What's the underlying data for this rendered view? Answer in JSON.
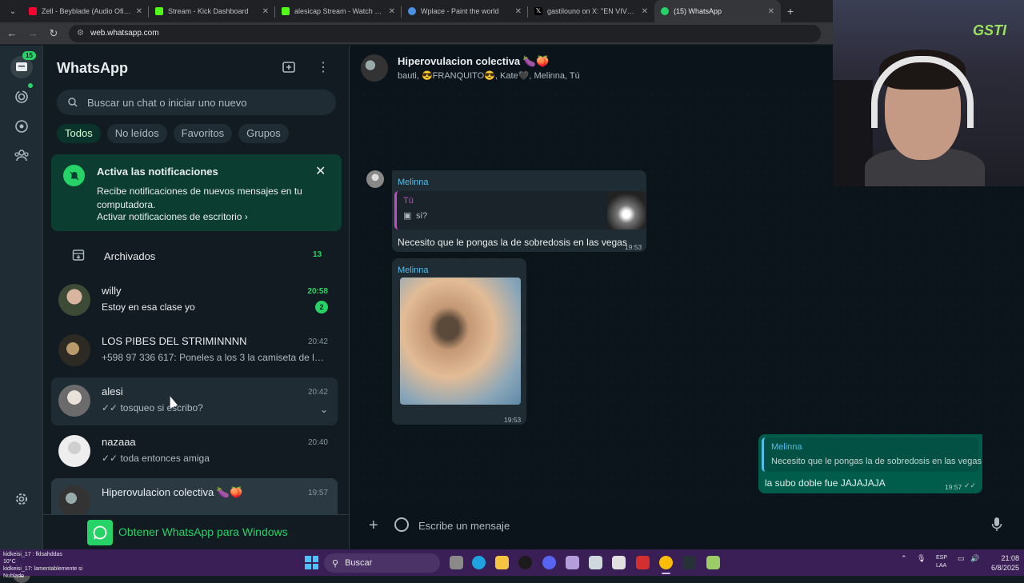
{
  "browser": {
    "tabs": [
      {
        "title": "Zell - Beyblade (Audio Oficial)",
        "color": "#ff0033"
      },
      {
        "title": "Stream - Kick Dashboard",
        "color": "#53fc18"
      },
      {
        "title": "alesicap Stream - Watch Live on",
        "color": "#53fc18"
      },
      {
        "title": "Wplace - Paint the world",
        "color": "#4a90e2"
      },
      {
        "title": "gastilouno on X: \"EN VIVOOO ❤",
        "color": "#000000"
      },
      {
        "title": "(15) WhatsApp",
        "color": "#25d366"
      }
    ],
    "new_tab_label": "+",
    "url": "web.whatsapp.com"
  },
  "rail": {
    "chats_badge": "15"
  },
  "sidebar": {
    "title": "WhatsApp",
    "search_placeholder": "Buscar un chat o iniciar uno nuevo",
    "filters": [
      "Todos",
      "No leídos",
      "Favoritos",
      "Grupos"
    ],
    "notification": {
      "title": "Activa las notificaciones",
      "body": "Recibe notificaciones de nuevos mensajes en tu computadora.",
      "link": "Activar notificaciones de escritorio"
    },
    "archived": {
      "label": "Archivados",
      "count": "13"
    },
    "chats": [
      {
        "name": "willy",
        "time": "20:58",
        "preview": "Estoy en esa clase yo",
        "unread": "2"
      },
      {
        "name": "LOS PIBES DEL STRIMINNNN",
        "time": "20:42",
        "preview": "+598 97 336 617: Poneles a los 3 la camiseta de la b..."
      },
      {
        "name": "alesi",
        "time": "20:42",
        "preview": "tosqueo si escribo?"
      },
      {
        "name": "nazaaa",
        "time": "20:40",
        "preview": "toda entonces amiga"
      },
      {
        "name": "Hiperovulacion colectiva 🍆🍑",
        "time": "19:57",
        "preview": ""
      }
    ],
    "get_app": "Obtener WhatsApp para Windows"
  },
  "conversation": {
    "title": "Hiperovulacion colectiva 🍆🍑",
    "members": "bauti, 😎FRANQUITO😎, Kate🖤, Melinna, Tú",
    "messages": [
      {
        "sender": "Melinna",
        "quote_author": "Tú",
        "quote_text": "si?",
        "text": "Necesito que le pongas la de sobredosis en las vegas",
        "time": "19:53"
      },
      {
        "sender": "Melinna",
        "time": "19:53"
      },
      {
        "quote_author": "Melinna",
        "quote_text": "Necesito que le pongas la de sobredosis en las vegas",
        "text": "la subo doble fue JAJAJAJA",
        "time": "19:57"
      }
    ],
    "composer_placeholder": "Escribe un mensaje"
  },
  "webcam": {
    "logo": "GSTI"
  },
  "taskbar": {
    "weather_lines": [
      "kidkeisi_17 : fklsahddas",
      "10°C",
      "kidkeisi_17: lamentablemente si",
      "Nublado"
    ],
    "search_label": "Buscar",
    "lang": "ESP",
    "lang2": "LAA",
    "time": "21:08",
    "date": "6/8/2025"
  }
}
